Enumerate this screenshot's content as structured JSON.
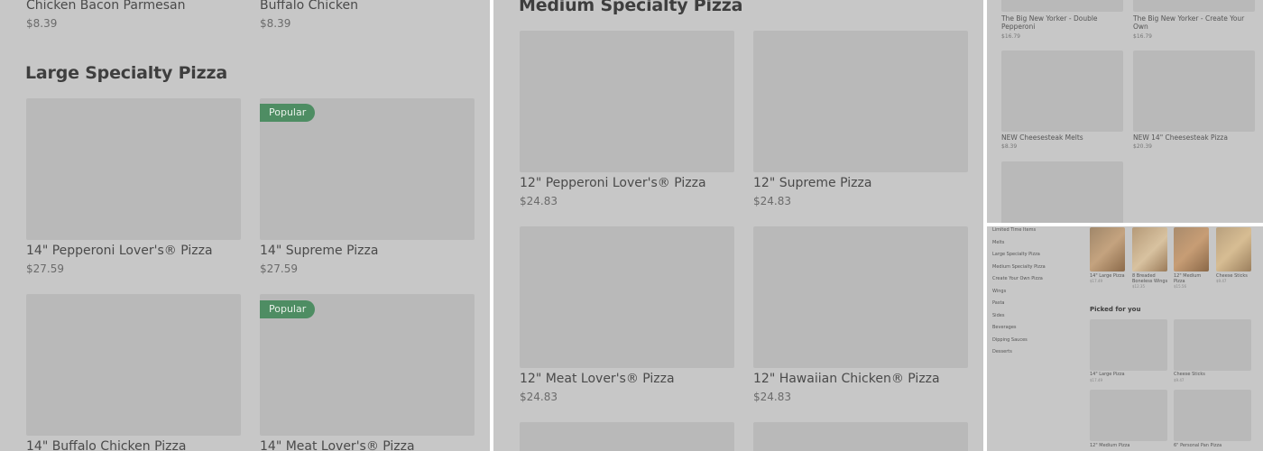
{
  "panelA": {
    "top_items": [
      {
        "name": "Chicken Bacon Parmesan",
        "price": "$8.39"
      },
      {
        "name": "Buffalo Chicken",
        "price": "$8.39"
      }
    ],
    "section_title": "Large Specialty Pizza",
    "badge_label": "Popular",
    "items": [
      {
        "name": "14\" Pepperoni Lover's® Pizza",
        "price": "$27.59"
      },
      {
        "name": "14\" Supreme Pizza",
        "price": "$27.59"
      },
      {
        "name": "14\" Buffalo Chicken Pizza",
        "price": ""
      },
      {
        "name": "14\" Meat Lover's® Pizza",
        "price": ""
      }
    ]
  },
  "panelB": {
    "section_title": "Medium Specialty Pizza",
    "items": [
      {
        "name": "12\" Pepperoni Lover's® Pizza",
        "price": "$24.83"
      },
      {
        "name": "12\" Supreme Pizza",
        "price": "$24.83"
      },
      {
        "name": "12\" Meat Lover's® Pizza",
        "price": "$24.83"
      },
      {
        "name": "12\" Hawaiian Chicken® Pizza",
        "price": "$24.83"
      }
    ]
  },
  "panelC": {
    "items": [
      {
        "name": "The Big New Yorker - Double Pepperoni",
        "price": "$16.79"
      },
      {
        "name": "The Big New Yorker - Create Your Own",
        "price": "$16.79"
      },
      {
        "name": "NEW Cheesesteak Melts",
        "price": "$8.39"
      },
      {
        "name": "NEW 14\" Cheesesteak Pizza",
        "price": "$20.39"
      }
    ]
  },
  "panelD": {
    "sidebar": [
      "Limited Time Items",
      "Melts",
      "Large Specialty Pizza",
      "Medium Specialty Pizza",
      "Create Your Own Pizza",
      "Wings",
      "Pasta",
      "Sides",
      "Beverages",
      "Dipping Sauces",
      "Desserts"
    ],
    "top_row": [
      {
        "name": "14\" Large Pizza",
        "price": "$17.49"
      },
      {
        "name": "8 Breaded Boneless Wings",
        "price": "$12.35"
      },
      {
        "name": "12\" Medium Pizza",
        "price": "$15.56"
      },
      {
        "name": "Cheese Sticks",
        "price": "$9.47"
      }
    ],
    "picked_title": "Picked for you",
    "picked": [
      {
        "name": "14\" Large Pizza",
        "price": "$17.49"
      },
      {
        "name": "Cheese Sticks",
        "price": "$9.47"
      },
      {
        "name": "12\" Medium Pizza",
        "price": ""
      },
      {
        "name": "6\" Personal Pan Pizza",
        "price": ""
      }
    ]
  },
  "colors": {
    "overlay_gray": "#c7c7c7",
    "placeholder": "#b9b9b9",
    "badge_green": "#4e8d63"
  }
}
